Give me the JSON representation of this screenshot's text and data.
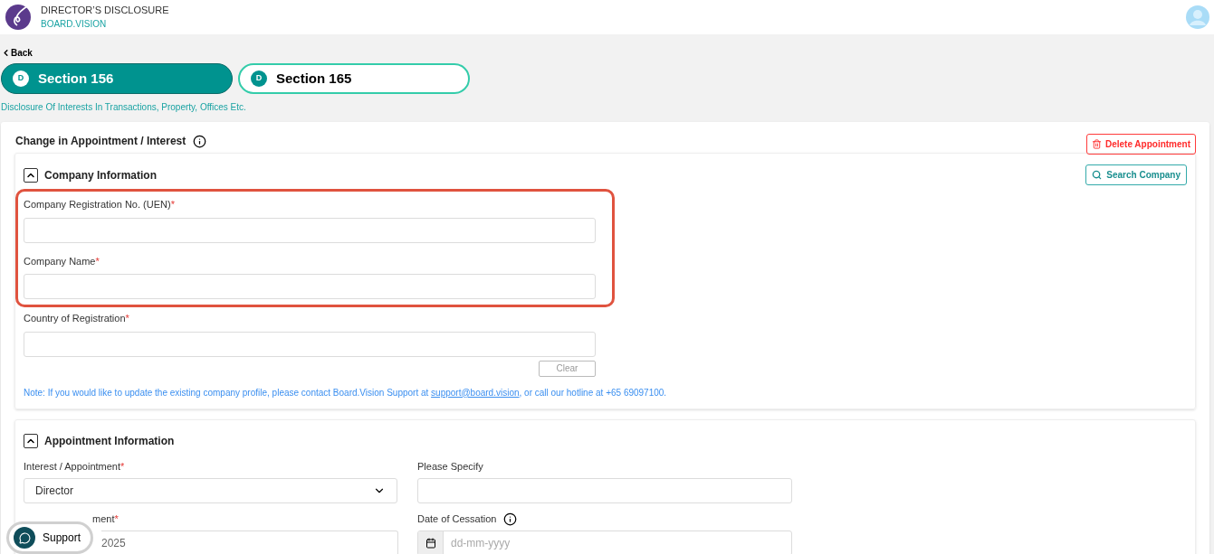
{
  "header": {
    "title": "DIRECTOR’S DISCLOSURE",
    "subtitle": "BOARD.VISION"
  },
  "back": "Back",
  "tabs": [
    {
      "badge": "D",
      "label": "Section 156",
      "selected": true
    },
    {
      "badge": "D",
      "label": "Section 165",
      "selected": false
    }
  ],
  "description": "Disclosure Of Interests In Transactions, Property, Offices Etc.",
  "card": {
    "title": "Change in Appointment / Interest",
    "info": true,
    "delete_button": "Delete Appointment"
  },
  "company_section": {
    "title": "Company Information",
    "expanded": true,
    "search_button": "Search Company",
    "fields": [
      {
        "label": "Company Registration No. (UEN)",
        "required_mark": "*",
        "highlighted": true
      },
      {
        "label": "Company Name",
        "required_mark": "*",
        "highlighted": true
      },
      {
        "label": "Country of Registration",
        "required_mark": "*",
        "highlighted": false
      }
    ],
    "clear_button": "Clear",
    "note": {
      "before": "Note: If you would like to update the existing company profile, please contact Board.Vision Support at ",
      "link": "support@board.vision",
      "after": ", or call our hotline at +65 69097100."
    }
  },
  "appointment_section": {
    "title": "Appointment Information",
    "expanded": true,
    "fields": [
      {
        "kind": "select",
        "label": "Interest / Appointment",
        "required_mark": "*",
        "value": "Director"
      },
      {
        "kind": "text",
        "label": "Please Specify"
      },
      {
        "kind": "date",
        "label": "ment",
        "required_mark": "*",
        "value": "2025"
      },
      {
        "kind": "date",
        "label": "Date of Cessation",
        "info": true,
        "placeholder": "dd-mm-yyyy"
      }
    ]
  },
  "support": "Support"
}
